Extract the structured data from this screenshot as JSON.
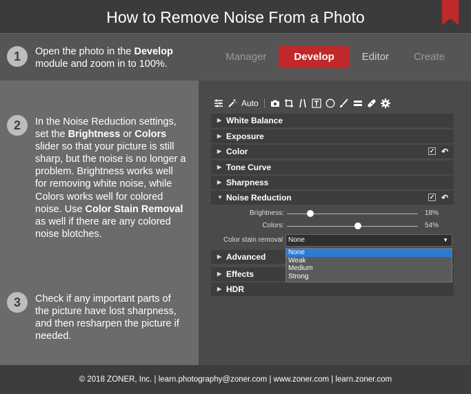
{
  "header": {
    "title": "How to Remove Noise From a Photo"
  },
  "steps": [
    {
      "num": "1",
      "pre": "Open the photo in the ",
      "bold": "Develop",
      "post": " module and zoom in to 100%."
    },
    {
      "num": "2"
    },
    {
      "num": "3",
      "text": "Check if any important parts of the picture have lost sharpness, and then resharpen the picture if needed."
    }
  ],
  "step2": {
    "t1": "In the Noise Reduction settings, set the ",
    "b1": "Brightness",
    "t2": " or ",
    "b2": "Colors",
    "t3": " slider so that your picture is still sharp, but the noise is no longer a problem. Brightness works well for removing white noise, while Colors works well for colored noise. Use ",
    "b3": "Color Stain Removal",
    "t4": " as well if there are any colored noise blotches."
  },
  "tabs": {
    "manager": "Manager",
    "develop": "Develop",
    "editor": "Editor",
    "create": "Create"
  },
  "toolbar": {
    "auto": "Auto"
  },
  "sections": {
    "white_balance": "White Balance",
    "exposure": "Exposure",
    "color": "Color",
    "tone_curve": "Tone Curve",
    "sharpness": "Sharpness",
    "noise_reduction": "Noise Reduction",
    "advanced": "Advanced",
    "effects": "Effects",
    "hdr": "HDR"
  },
  "sliders": {
    "brightness": {
      "label": "Brightness:",
      "value": "18%",
      "fraction": 0.18
    },
    "colors": {
      "label": "Colors:",
      "value": "54%",
      "fraction": 0.54
    }
  },
  "stain": {
    "label": "Color stain removal",
    "selected": "None",
    "options": [
      "None",
      "Weak",
      "Medium",
      "Strong"
    ]
  },
  "footer": {
    "text": "© 2018 ZONER, Inc.  |  learn.photography@zoner.com  |  www.zoner.com  |  learn.zoner.com"
  },
  "colors": {
    "accent": "#c0282a",
    "selection": "#2a7bd4"
  }
}
